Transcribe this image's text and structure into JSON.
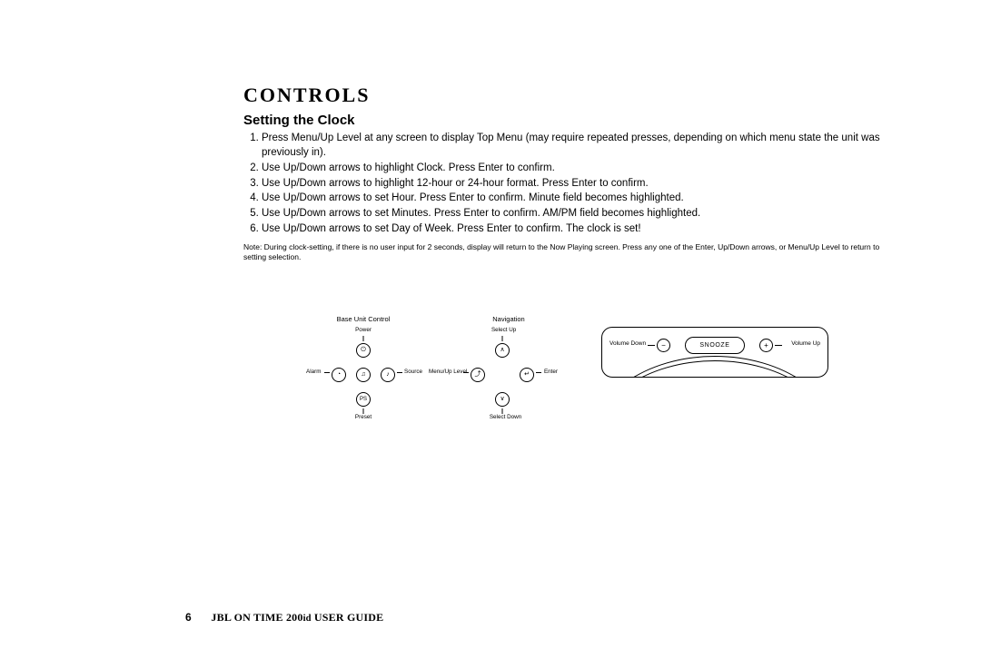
{
  "heading": "CONTROLS",
  "subheading": "Setting the Clock",
  "steps": [
    "Press Menu/Up Level at any screen to display Top Menu (may require repeated presses, depending on which menu state the unit was previously in).",
    "Use Up/Down arrows to highlight Clock. Press Enter to confirm.",
    "Use Up/Down arrows to highlight 12-hour or 24-hour format. Press Enter to confirm.",
    "Use Up/Down arrows to set Hour. Press Enter to confirm. Minute field becomes highlighted.",
    "Use Up/Down arrows to set Minutes. Press Enter to confirm. AM/PM field becomes highlighted.",
    "Use Up/Down arrows to set Day of Week. Press Enter to confirm. The clock is set!"
  ],
  "note": "Note: During clock-setting, if there is no user input for 2 seconds, display will return to the Now Playing screen. Press any one of the Enter, Up/Down arrows, or Menu/Up Level to return to setting selection.",
  "base": {
    "title": "Base Unit Control",
    "power": "Power",
    "alarm": "Alarm",
    "source": "Source",
    "preset": "Preset",
    "preset_icon": "PS"
  },
  "nav": {
    "title": "Navigation",
    "up": "Select Up",
    "down": "Select Down",
    "left": "Menu/Up Level",
    "right": "Enter"
  },
  "device": {
    "voldown": "Volume Down",
    "volup": "Volume Up",
    "snooze": "SNOOZE",
    "minus": "−",
    "plus": "+"
  },
  "footer": {
    "page": "6",
    "title_a": "JBL ON TIME 200",
    "title_b": "iD",
    "title_c": " USER GUIDE"
  }
}
